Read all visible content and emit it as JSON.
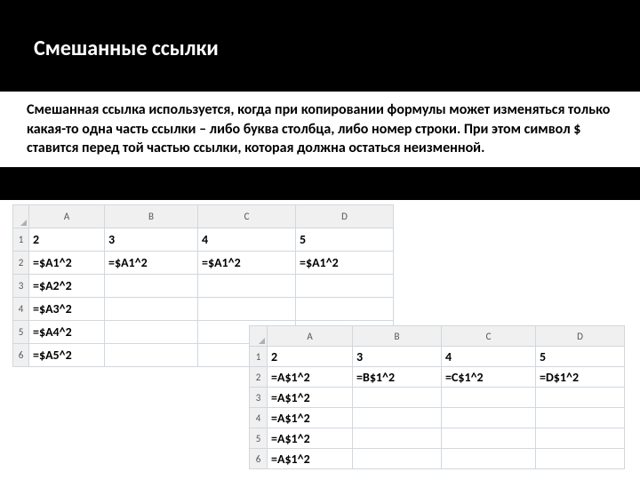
{
  "title": "Смешанные ссылки",
  "description": "Смешанная ссылка используется, когда при копировании формулы может изменяться только какая-то одна часть ссылки – либо буква столбца, либо номер строки. При этом символ $ ставится перед той частью ссылки, которая должна остаться неизменной.",
  "sheet1": {
    "cols": [
      "A",
      "B",
      "C",
      "D"
    ],
    "rows": [
      {
        "n": "1",
        "c": [
          "2",
          "3",
          "4",
          "5"
        ]
      },
      {
        "n": "2",
        "c": [
          "=$A1^2",
          "=$A1^2",
          "=$A1^2",
          "=$A1^2"
        ]
      },
      {
        "n": "3",
        "c": [
          "=$A2^2",
          "",
          "",
          ""
        ]
      },
      {
        "n": "4",
        "c": [
          "=$A3^2",
          "",
          "",
          ""
        ]
      },
      {
        "n": "5",
        "c": [
          "=$A4^2",
          "",
          "",
          ""
        ]
      },
      {
        "n": "6",
        "c": [
          "=$A5^2",
          "",
          "",
          ""
        ]
      }
    ]
  },
  "sheet2": {
    "cols": [
      "A",
      "B",
      "C",
      "D"
    ],
    "rows": [
      {
        "n": "1",
        "c": [
          "2",
          "3",
          "4",
          "5"
        ]
      },
      {
        "n": "2",
        "c": [
          "=A$1^2",
          "=B$1^2",
          "=C$1^2",
          "=D$1^2"
        ]
      },
      {
        "n": "3",
        "c": [
          "=A$1^2",
          "",
          "",
          ""
        ]
      },
      {
        "n": "4",
        "c": [
          "=A$1^2",
          "",
          "",
          ""
        ]
      },
      {
        "n": "5",
        "c": [
          "=A$1^2",
          "",
          "",
          ""
        ]
      },
      {
        "n": "6",
        "c": [
          "=A$1^2",
          "",
          "",
          ""
        ]
      }
    ]
  }
}
